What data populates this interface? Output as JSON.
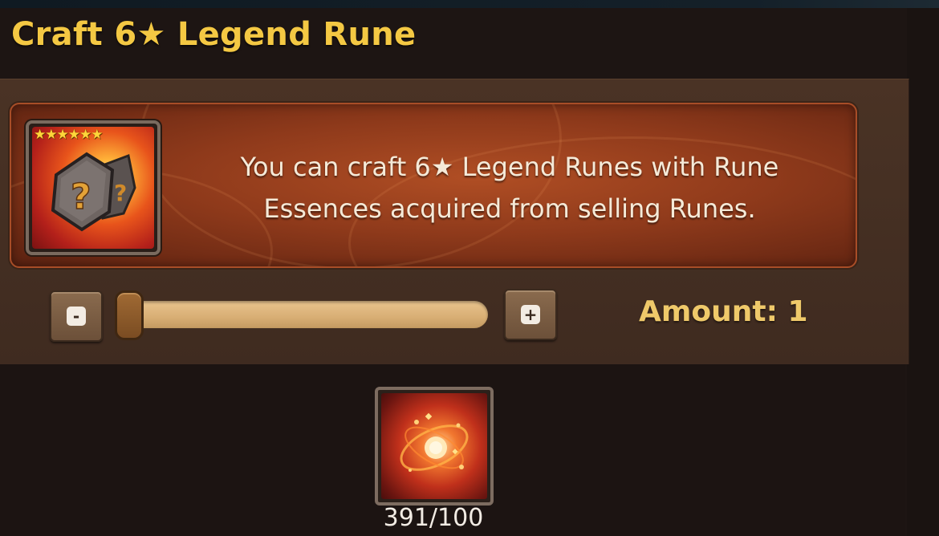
{
  "title": "Craft 6★ Legend Rune",
  "rune_card": {
    "stars": "★★★★★★",
    "star_count": 6,
    "icon": "mystery-rune-icon"
  },
  "info": {
    "line1": "You can craft 6★ Legend Runes with Rune",
    "line2": "Essences acquired from selling Runes."
  },
  "controls": {
    "minus_label": "-",
    "plus_label": "+",
    "slider_value": 1
  },
  "amount_label": "Amount: 1",
  "essence": {
    "icon": "rune-essence-icon",
    "count": "391/100"
  },
  "colors": {
    "title": "#f4c843",
    "amount": "#efc96a",
    "info_box": "#8f3a1b"
  }
}
